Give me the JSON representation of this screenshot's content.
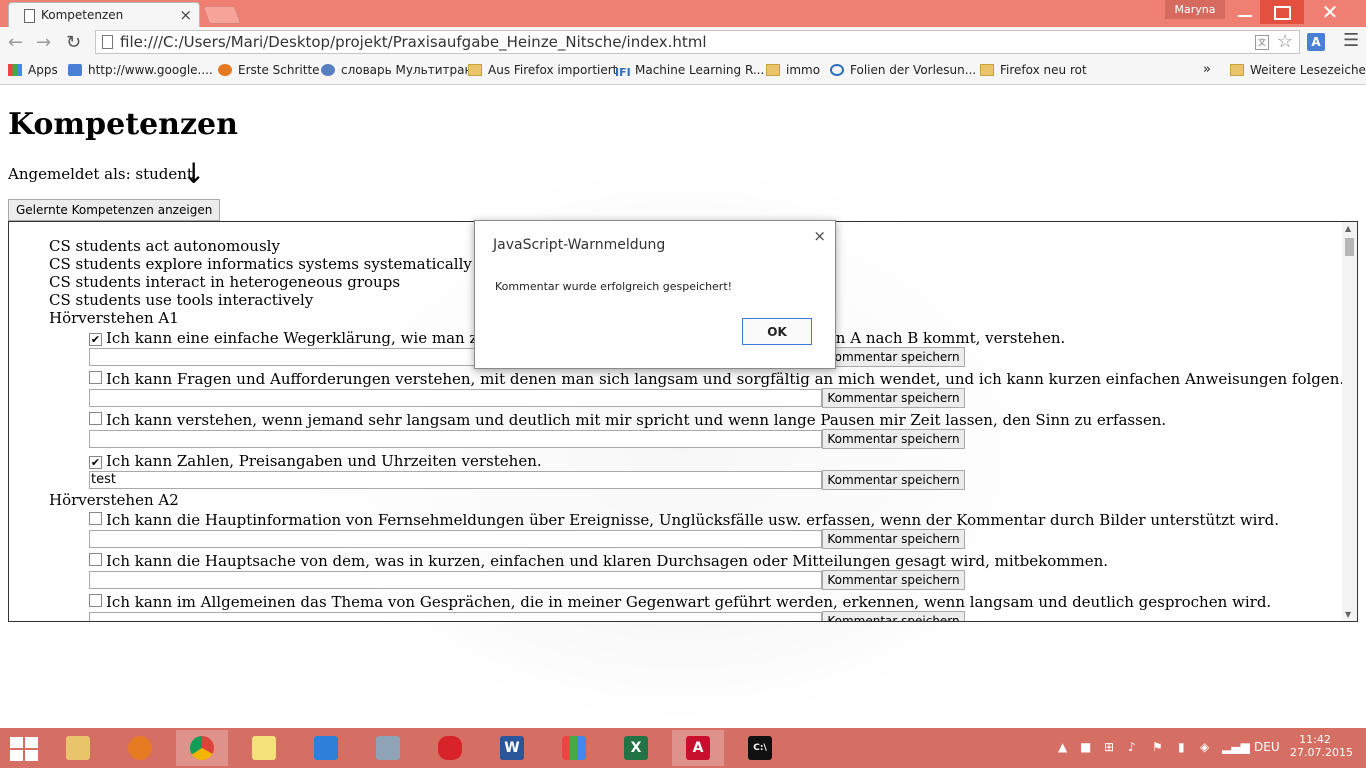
{
  "browser": {
    "tab_title": "Kompetenzen",
    "tab_close": "×",
    "user_name": "Maryna",
    "url": "file:///C:/Users/Mari/Desktop/projekt/Praxisaufgabe_Heinze_Nitsche/index.html",
    "nav": {
      "back": "←",
      "forward": "→",
      "reload": "↻"
    },
    "bookmarks": [
      {
        "label": "Apps",
        "icon": "apps-grid-icon"
      },
      {
        "label": "http://www.google....",
        "icon": "google-icon"
      },
      {
        "label": "Erste Schritte",
        "icon": "firefox-icon"
      },
      {
        "label": "словарь Мультитран",
        "icon": "dictionary-icon"
      },
      {
        "label": "Aus Firefox importiert",
        "icon": "folder-icon"
      },
      {
        "label": "Machine Learning R...",
        "icon": "ifi-icon"
      },
      {
        "label": "immo",
        "icon": "folder-icon"
      },
      {
        "label": "Folien der Vorlesun...",
        "icon": "globe-icon"
      },
      {
        "label": "Firefox neu rot",
        "icon": "folder-icon"
      },
      {
        "label": "Weitere Lesezeichen",
        "icon": "folder-icon"
      }
    ],
    "more_bookmarks": "»",
    "ifi_label": "IFI"
  },
  "page": {
    "title": "Kompetenzen",
    "logged_in": "Angemeldet als: student",
    "show_button": "Gelernte Kompetenzen anzeigen",
    "save_label": "Kommentar speichern",
    "general": [
      "CS students act autonomously",
      "CS students explore informatics systems systematically",
      "CS students interact in heterogeneous groups",
      "CS students use tools interactively"
    ],
    "groups": [
      {
        "name": "Hörverstehen A1",
        "items": [
          {
            "text": "Ich kann eine einfache Wegerklärung, wie man zu Fuß oder mit öffentlichen Verkehrsmitteln von A nach B kommt, verstehen.",
            "checked": true,
            "comment": ""
          },
          {
            "text": "Ich kann Fragen und Aufforderungen verstehen, mit denen man sich langsam und sorgfältig an mich wendet, und ich kann kurzen einfachen Anweisungen folgen.",
            "checked": false,
            "comment": ""
          },
          {
            "text": "Ich kann verstehen, wenn jemand sehr langsam und deutlich mit mir spricht und wenn lange Pausen mir Zeit lassen, den Sinn zu erfassen.",
            "checked": false,
            "comment": ""
          },
          {
            "text": "Ich kann Zahlen, Preisangaben und Uhrzeiten verstehen.",
            "checked": true,
            "comment": "test"
          }
        ]
      },
      {
        "name": "Hörverstehen A2",
        "items": [
          {
            "text": "Ich kann die Hauptinformation von Fernsehmeldungen über Ereignisse, Unglücksfälle usw. erfassen, wenn der Kommentar durch Bilder unterstützt wird.",
            "checked": false,
            "comment": ""
          },
          {
            "text": "Ich kann die Hauptsache von dem, was in kurzen, einfachen und klaren Durchsagen oder Mitteilungen gesagt wird, mitbekommen.",
            "checked": false,
            "comment": ""
          },
          {
            "text": "Ich kann im Allgemeinen das Thema von Gesprächen, die in meiner Gegenwart geführt werden, erkennen, wenn langsam und deutlich gesprochen wird.",
            "checked": false,
            "comment": ""
          }
        ]
      }
    ],
    "checkmark": "✔"
  },
  "dialog": {
    "title": "JavaScript-Warnmeldung",
    "message": "Kommentar wurde erfolgreich gespeichert!",
    "ok": "OK",
    "close": "×"
  },
  "taskbar": {
    "language": "DEU",
    "time": "11:42",
    "date": "27.07.2015",
    "apps": [
      "file-explorer-icon",
      "firefox-icon",
      "chrome-icon",
      "sticky-notes-icon",
      "dropbox-icon",
      "calculator-icon",
      "paint-icon",
      "word-icon",
      "apps-icon",
      "excel-icon",
      "acrobat-icon",
      "cmd-icon"
    ]
  }
}
